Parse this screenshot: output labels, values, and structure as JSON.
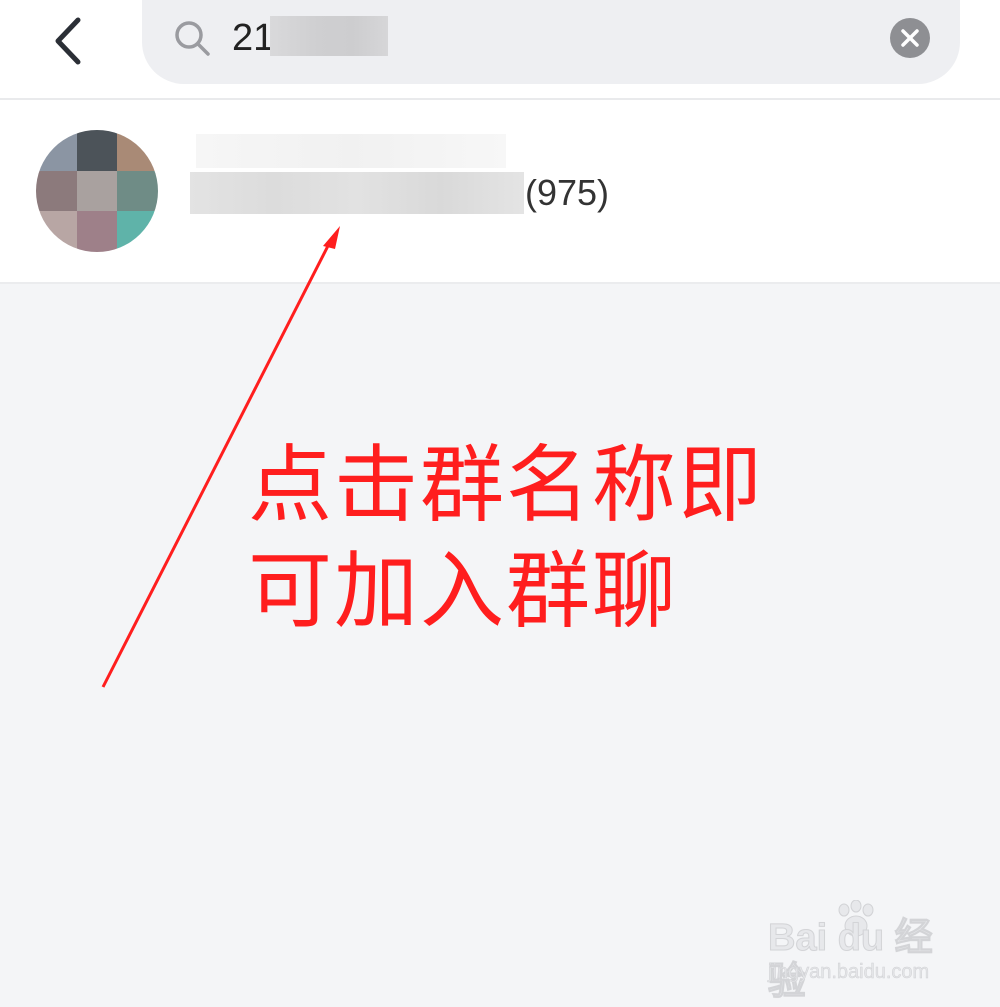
{
  "header": {
    "back_icon": "chevron-left-icon",
    "search": {
      "icon": "search-icon",
      "value": "21",
      "clear_icon": "close-circle-icon"
    }
  },
  "results": [
    {
      "member_count": "(975)"
    }
  ],
  "annotation": {
    "line1": "点击群名称即",
    "line2": "可加入群聊",
    "color": "#ff1e1e"
  },
  "watermark": {
    "logo": "Bai du 经验",
    "url": "jingyan.baidu.com"
  },
  "colors": {
    "background": "#f4f5f7",
    "search_bg": "#eeeff2",
    "clear_button": "#8e8f93"
  }
}
